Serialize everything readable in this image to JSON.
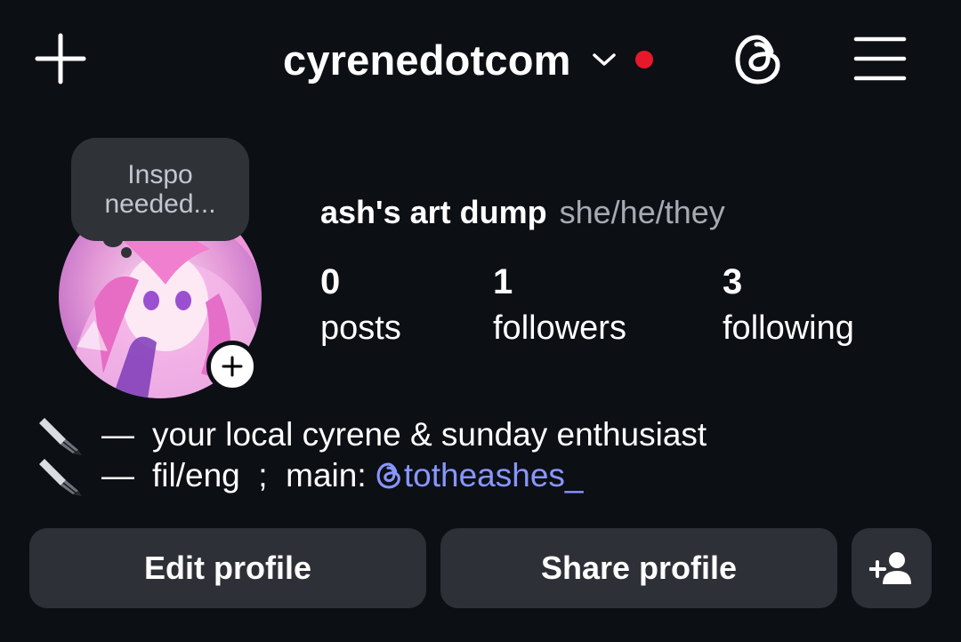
{
  "header": {
    "username": "cyrenedotcom",
    "notification_color": "#e8182b",
    "icons": {
      "new": "plus-icon",
      "switch": "chevron-down-icon",
      "threads": "threads-icon",
      "menu": "hamburger-menu-icon"
    }
  },
  "note": {
    "line1": "Inspo",
    "line2": "needed..."
  },
  "profile": {
    "display_name": "ash's art dump",
    "pronouns": "she/he/they",
    "stats": [
      {
        "value": "0",
        "label": "posts"
      },
      {
        "value": "1",
        "label": "followers"
      },
      {
        "value": "3",
        "label": "following"
      }
    ]
  },
  "bio": {
    "line1": {
      "icon": "fountain-pen-icon",
      "dash": "—",
      "text": "your local cyrene & sunday enthusiast"
    },
    "line2": {
      "icon": "fountain-pen-icon",
      "dash": "—",
      "text": "fil/eng  ;  main: ",
      "mention": "totheashes_"
    }
  },
  "actions": {
    "edit_label": "Edit profile",
    "share_label": "Share profile",
    "add_user_icon": "add-person-icon"
  },
  "colors": {
    "background": "#0c0f14",
    "button": "#2d3036",
    "mention": "#8896ff",
    "muted": "#a7aab0"
  }
}
